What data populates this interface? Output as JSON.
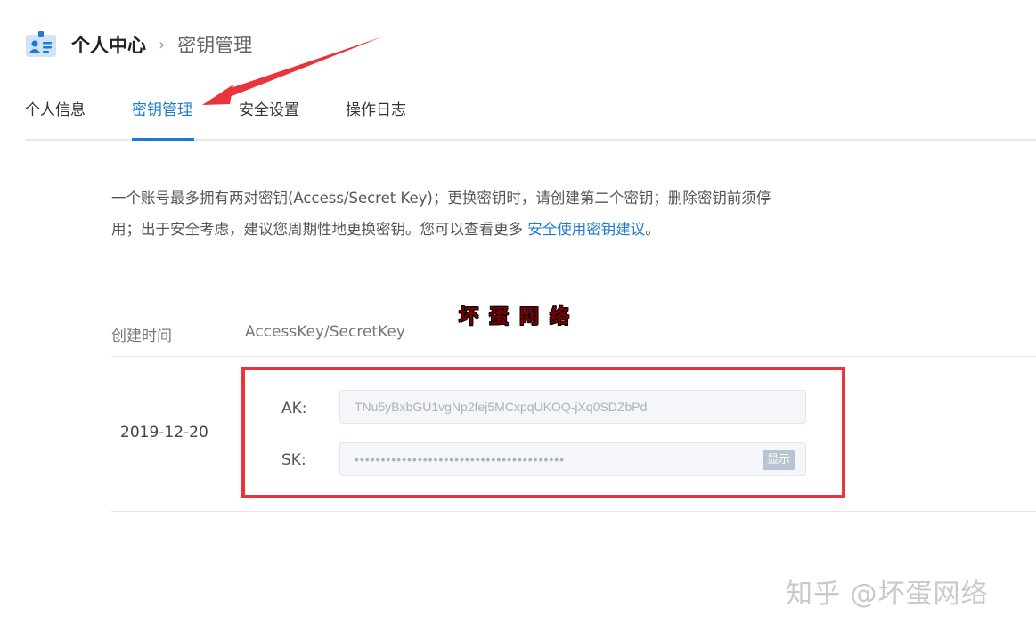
{
  "header": {
    "icon": "contact-card-icon",
    "root": "个人中心",
    "separator": "›",
    "current": "密钥管理"
  },
  "tabs": [
    {
      "label": "个人信息",
      "active": false
    },
    {
      "label": "密钥管理",
      "active": true
    },
    {
      "label": "安全设置",
      "active": false
    },
    {
      "label": "操作日志",
      "active": false
    }
  ],
  "description": {
    "line1": "一个账号最多拥有两对密钥(Access/Secret Key)；更换密钥时，请创建第二个密钥；删除密钥前须停",
    "line2_text": "用；出于安全考虑，建议您周期性地更换密钥。您可以查看更多 ",
    "line2_link": "安全使用密钥建议",
    "line2_end": "。"
  },
  "table": {
    "columns": [
      "创建时间",
      "AccessKey/SecretKey"
    ],
    "row": {
      "date": "2019-12-20",
      "ak_label": "AK:",
      "ak_value": "TNu5yBxbGU1vgNp2fej5MCxpqUKOQ-jXq0SDZbPd",
      "sk_label": "SK:",
      "sk_value": "••••••••••••••••••••••••••••••••••••••••",
      "show_label": "显示"
    }
  },
  "watermarks": {
    "overlay": "坏蛋网络",
    "corner": "知乎 @坏蛋网络"
  },
  "colors": {
    "accent": "#1f7bd0",
    "highlight": "#e8343a"
  }
}
